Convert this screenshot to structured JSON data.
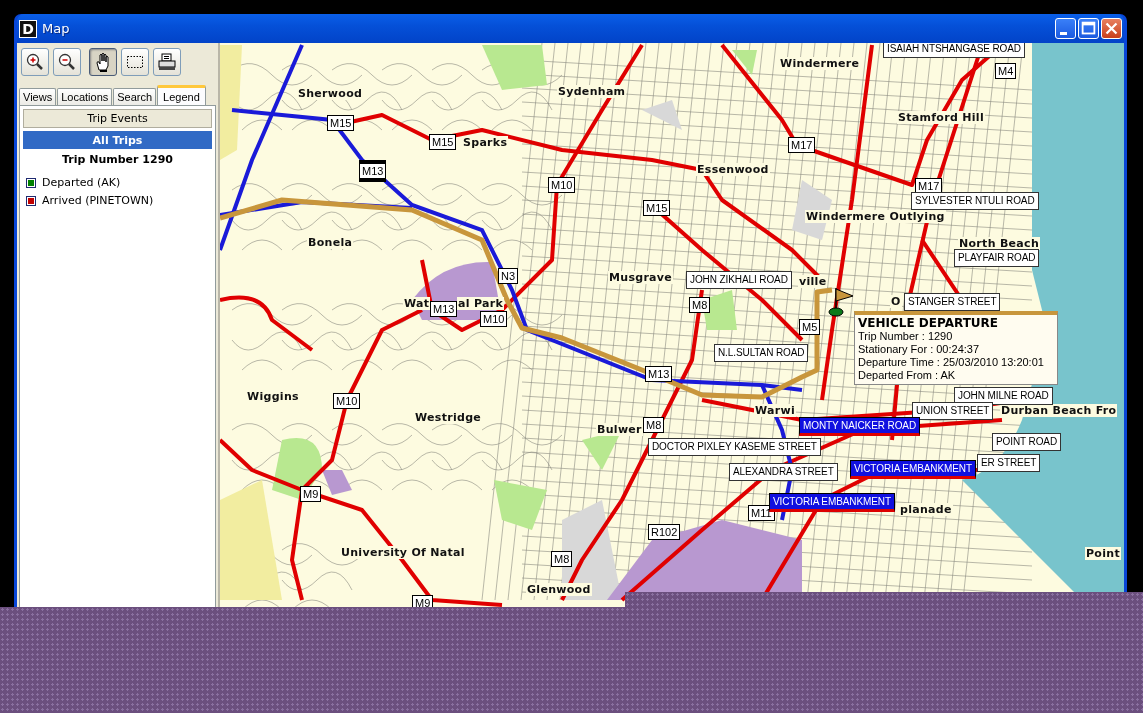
{
  "window": {
    "icon_text": "D",
    "title": "Map",
    "controls": [
      {
        "kind": "minimize"
      },
      {
        "kind": "maximize"
      },
      {
        "kind": "close"
      }
    ]
  },
  "toolbar": [
    {
      "kind": "zoom-in",
      "selected": false
    },
    {
      "kind": "zoom-out",
      "selected": false
    },
    {
      "kind": "pan",
      "selected": true
    },
    {
      "kind": "select-area",
      "selected": false
    },
    {
      "kind": "print",
      "selected": false
    }
  ],
  "tabs": [
    {
      "label": "Views",
      "selected": false
    },
    {
      "label": "Locations",
      "selected": false
    },
    {
      "label": "Search",
      "selected": false
    },
    {
      "label": "Legend",
      "selected": true
    }
  ],
  "legend": {
    "header": "Trip Events",
    "group": "All Trips",
    "trip_title": "Trip Number 1290",
    "events": [
      {
        "label": "Departed (AK)",
        "color": "#008000"
      },
      {
        "label": "Arrived (PINETOWN)",
        "color": "#c00000"
      }
    ]
  },
  "map": {
    "place_labels": [
      "Windermere",
      "Sherwood",
      "Sydenham",
      "Stamford Hill",
      "Sparks",
      "Essenwood",
      "Windermere Outlying",
      "Bonela",
      "North Beach",
      "Musgrave",
      "ville",
      "Wat",
      "al Park",
      "O",
      "Wiggins",
      "Westridge",
      "Bulwer",
      "Warwi",
      "Durban Beach Fro",
      "planade",
      "University Of Natal",
      "Point",
      "Glenwood"
    ],
    "road_shields": [
      "M15",
      "M15",
      "M13",
      "M10",
      "M15",
      "M17",
      "M17",
      "M4",
      "N3",
      "M13",
      "M10",
      "M8",
      "M5",
      "M13",
      "M10",
      "M8",
      "M9",
      "M11",
      "R102",
      "M8",
      "M9"
    ],
    "street_labels": [
      {
        "text": "ISAIAH NTSHANGASE ROAD",
        "kind": "plain"
      },
      {
        "text": "SYLVESTER NTULI ROAD",
        "kind": "plain"
      },
      {
        "text": "PLAYFAIR ROAD",
        "kind": "plain"
      },
      {
        "text": "JOHN ZIKHALI ROAD",
        "kind": "plain"
      },
      {
        "text": "STANGER STREET",
        "kind": "plain"
      },
      {
        "text": "N.L.SULTAN ROAD",
        "kind": "plain"
      },
      {
        "text": "JOHN MILNE ROAD",
        "kind": "plain"
      },
      {
        "text": "UNION STREET",
        "kind": "plain"
      },
      {
        "text": "MONTY NAICKER ROAD",
        "kind": "route"
      },
      {
        "text": "DOCTOR PIXLEY KASEME STREET",
        "kind": "plain"
      },
      {
        "text": "POINT ROAD",
        "kind": "plain"
      },
      {
        "text": "ALEXANDRA STREET",
        "kind": "plain"
      },
      {
        "text": "VICTORIA EMBANKMENT",
        "kind": "route"
      },
      {
        "text": "ER STREET",
        "kind": "plain"
      },
      {
        "text": "VICTORIA EMBANKMENT",
        "kind": "route"
      }
    ],
    "popup": {
      "title": "VEHICLE DEPARTURE",
      "lines": [
        "Trip Number : 1290",
        "Stationary For :  00:24:37",
        "Departure Time : 25/03/2010 13:20:01",
        "Departed From : AK"
      ]
    }
  }
}
